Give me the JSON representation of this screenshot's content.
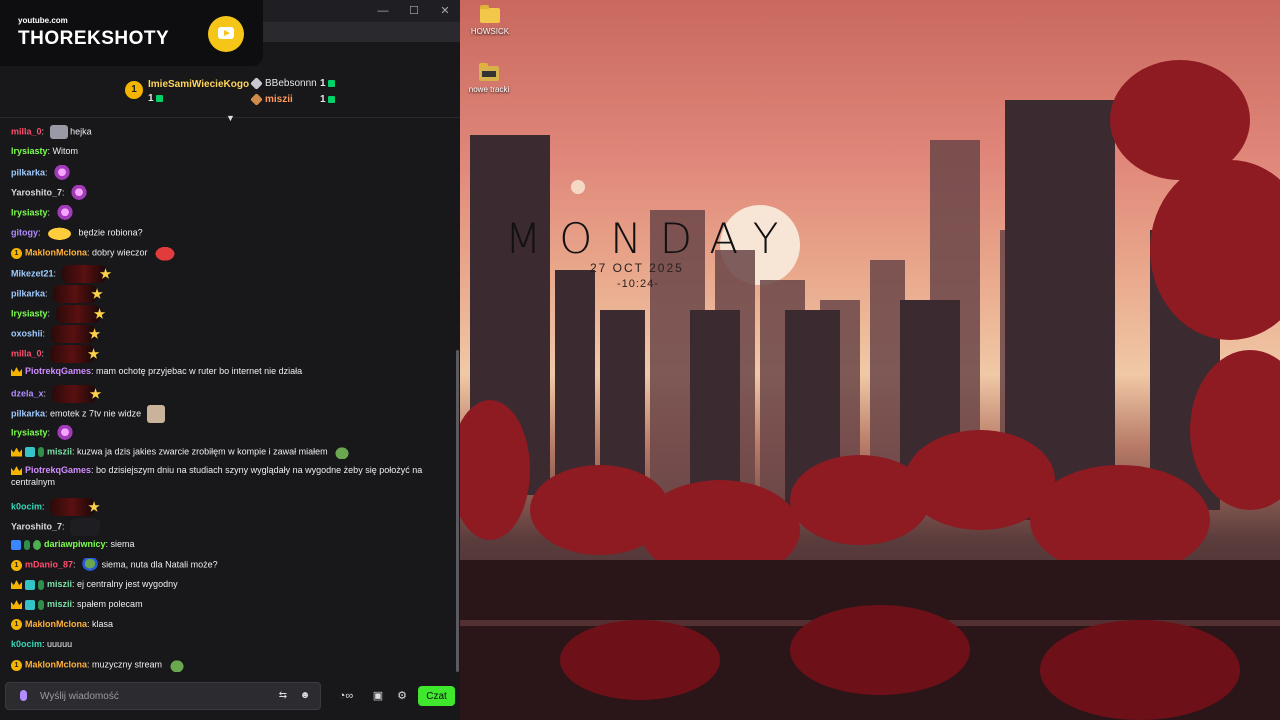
{
  "branding": {
    "site": "youtube.com",
    "channel": "THOREKSHOTY"
  },
  "window": {
    "minimize": "—",
    "maximize": "☐",
    "close": "✕"
  },
  "leaderboard": {
    "first": {
      "rank": "1",
      "name": "ImieSamiWiecieKogo",
      "count": "1"
    },
    "second": {
      "name": "BBebsonnn",
      "count": "1"
    },
    "third": {
      "name": "miszii",
      "count": "1"
    }
  },
  "messages": [
    {
      "user": "milla_0",
      "color": "#ff4d6d",
      "text": "hejka"
    },
    {
      "user": "lrysiasty",
      "color": "#7cff4d",
      "text": "Witom"
    },
    {
      "user": "pilkarka",
      "color": "#9ecbff",
      "text": ""
    },
    {
      "user": "Yaroshito_7",
      "color": "#d8d8d8",
      "text": ""
    },
    {
      "user": "lrysiasty",
      "color": "#7cff4d",
      "text": ""
    },
    {
      "user": "gitogy",
      "color": "#b08cff",
      "text": "będzie robiona?"
    },
    {
      "user": "MaklonMclona",
      "color": "#ffb13b",
      "text": "dobry wieczor"
    },
    {
      "user": "Mikezet21",
      "color": "#9ecbff",
      "text": ""
    },
    {
      "user": "pilkarka",
      "color": "#9ecbff",
      "text": ""
    },
    {
      "user": "lrysiasty",
      "color": "#7cff4d",
      "text": ""
    },
    {
      "user": "oxoshii",
      "color": "#9ecbff",
      "text": ""
    },
    {
      "user": "milla_0",
      "color": "#ff4d6d",
      "text": ""
    },
    {
      "user": "PiotrekqGames",
      "color": "#d08cff",
      "text": "mam ochotę przyjebac w ruter bo internet nie działa"
    },
    {
      "user": "dzela_x",
      "color": "#b08cff",
      "text": ""
    },
    {
      "user": "pilkarka",
      "color": "#9ecbff",
      "text": "emotek z 7tv nie widze"
    },
    {
      "user": "lrysiasty",
      "color": "#7cff4d",
      "text": ""
    },
    {
      "user": "miszii",
      "color": "#7be0a8",
      "text": "kuzwa ja dzis jakies zwarcie zrobiłęm w kompie i zawał miałem"
    },
    {
      "user": "PiotrekqGames",
      "color": "#d08cff",
      "text": "bo dzisiejszym dniu na studiach szyny wyglądały na wygodne żeby się położyć na centralnym"
    },
    {
      "user": "k0ocim",
      "color": "#36d6b6",
      "text": ""
    },
    {
      "user": "Yaroshito_7",
      "color": "#d8d8d8",
      "text": ""
    },
    {
      "user": "dariawpiwnicy",
      "color": "#7cff4d",
      "text": "siema"
    },
    {
      "user": "mDanio_87",
      "color": "#ff4d6d",
      "text": "siema, nuta dla Natali może?"
    },
    {
      "user": "miszii",
      "color": "#7be0a8",
      "text": "ej centralny jest wygodny"
    },
    {
      "user": "miszii",
      "color": "#7be0a8",
      "text": "spałem polecam"
    },
    {
      "user": "MaklonMclona",
      "color": "#ffb13b",
      "text": "klasa"
    },
    {
      "user": "k0ocim",
      "color": "#36d6b6",
      "text": "uuuuu"
    },
    {
      "user": "MaklonMclona",
      "color": "#ffb13b",
      "text": "muzyczny stream"
    }
  ],
  "input": {
    "placeholder": "Wyślij wiadomość",
    "chat_button": "Czat"
  },
  "desktop": {
    "icons": [
      {
        "label": "HOWSICK"
      },
      {
        "label": "nowe tracki"
      }
    ],
    "clock": {
      "day": "MONDAY",
      "date": "27 OCT 2025",
      "time": "-10:24-"
    }
  }
}
